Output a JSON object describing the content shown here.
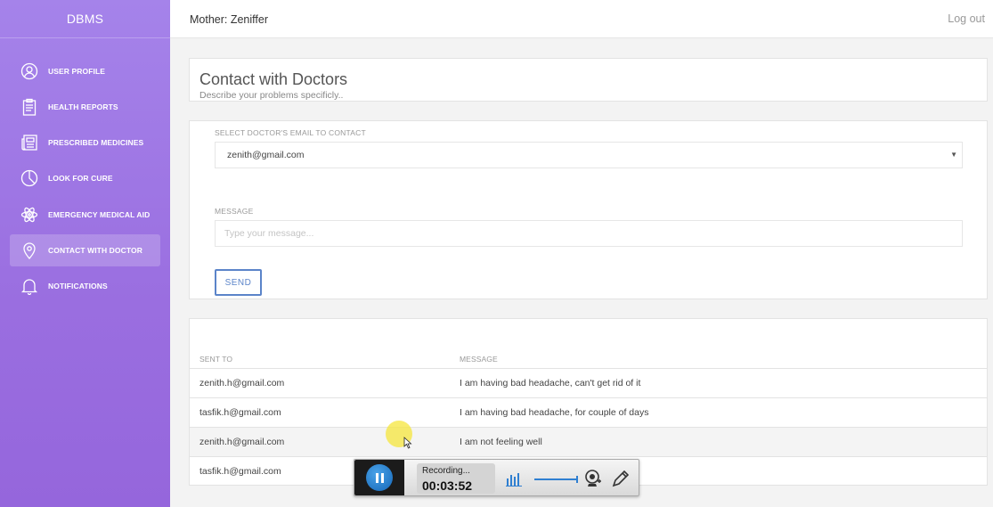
{
  "app": {
    "brand": "DBMS"
  },
  "header": {
    "title": "Mother: Zeniffer",
    "logout_label": "Log out"
  },
  "sidebar": {
    "items": [
      {
        "label": "USER PROFILE",
        "icon": "user-icon"
      },
      {
        "label": "HEALTH REPORTS",
        "icon": "clipboard-icon"
      },
      {
        "label": "PRESCRIBED MEDICINES",
        "icon": "newspaper-icon"
      },
      {
        "label": "LOOK FOR CURE",
        "icon": "pie-chart-icon"
      },
      {
        "label": "EMERGENCY MEDICAL AID",
        "icon": "atom-icon"
      },
      {
        "label": "CONTACT WITH DOCTOR",
        "icon": "map-pin-icon",
        "active": true
      },
      {
        "label": "NOTIFICATIONS",
        "icon": "bell-icon"
      }
    ]
  },
  "page": {
    "title": "Contact with Doctors",
    "subtitle": "Describe your problems specificly.."
  },
  "form": {
    "select_label": "SELECT DOCTOR'S EMAIL TO CONTACT",
    "selected_email": "zenith@gmail.com",
    "message_label": "MESSAGE",
    "message_placeholder": "Type your message...",
    "message_value": "",
    "send_label": "SEND"
  },
  "messages": {
    "columns": [
      "SENT TO",
      "MESSAGE"
    ],
    "rows": [
      {
        "sent_to": "zenith.h@gmail.com",
        "message": "I am having bad headache, can't get rid of it"
      },
      {
        "sent_to": "tasfik.h@gmail.com",
        "message": "I am having bad headache, for couple of days"
      },
      {
        "sent_to": "zenith.h@gmail.com",
        "message": "I am not feeling well"
      },
      {
        "sent_to": "tasfik.h@gmail.com",
        "message": ""
      }
    ]
  },
  "recorder": {
    "status": "Recording...",
    "time": "00:03:52"
  },
  "colors": {
    "sidebar": "#9a6ee0",
    "accent": "#5b84c9"
  }
}
